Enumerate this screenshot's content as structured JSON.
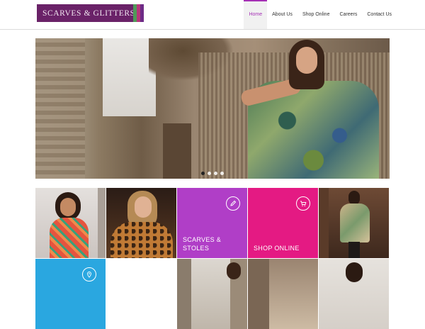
{
  "brand": {
    "logo_text": "SCARVES & GLITTERS",
    "stripe_colors": [
      "#4f9a58",
      "#b8357a",
      "#6e2b86"
    ]
  },
  "nav": {
    "items": [
      {
        "label": "Home",
        "active": true
      },
      {
        "label": "About Us",
        "active": false
      },
      {
        "label": "Shop Online",
        "active": false
      },
      {
        "label": "Careers",
        "active": false
      },
      {
        "label": "Contact Us",
        "active": false
      }
    ]
  },
  "hero": {
    "slide_count": 4,
    "active_slide": 1
  },
  "tiles": [
    {
      "label": "SCARVES &\nSTOLES",
      "color": "#b03ec7",
      "icon": "pencil-icon"
    },
    {
      "label": "SHOP ONLINE",
      "color": "#e41a83",
      "icon": "cart-icon"
    },
    {
      "label": "",
      "color": "#2aa7e0",
      "icon": "location-pin-icon"
    }
  ],
  "colors": {
    "accent": "#a52fb5",
    "brand": "#6a2268"
  }
}
